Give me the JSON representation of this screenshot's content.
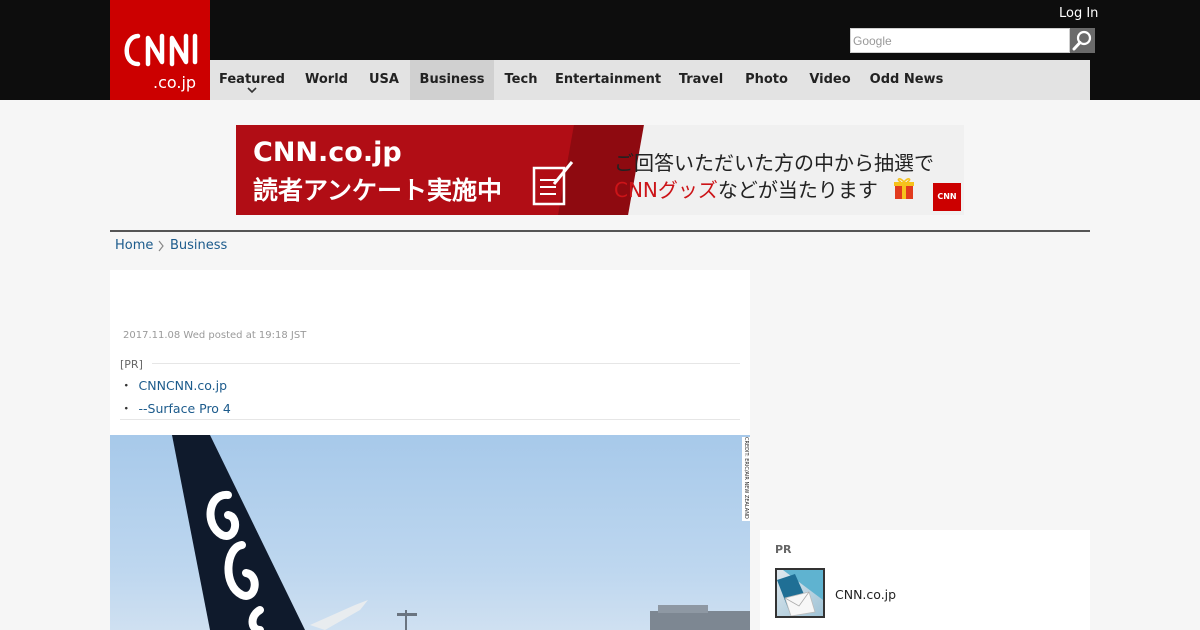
{
  "header": {
    "logo_text": "CNN.co.jp",
    "login_label": "Log In",
    "search_placeholder": "Google"
  },
  "nav": {
    "items": [
      {
        "label": "Featured"
      },
      {
        "label": "World"
      },
      {
        "label": "USA"
      },
      {
        "label": "Business"
      },
      {
        "label": "Tech"
      },
      {
        "label": "Entertainment"
      },
      {
        "label": "Travel"
      },
      {
        "label": "Photo"
      },
      {
        "label": "Video"
      },
      {
        "label": "Odd News"
      }
    ],
    "active": "Business"
  },
  "banner": {
    "line1": "CNN.co.jp",
    "line2": "読者アンケート実施中",
    "right_line1": "ご回答いただいた方の中から抽選で",
    "right_line2_red": "CNNグッズ",
    "right_line2_rest": "などが当たります",
    "logo_text": "CNN"
  },
  "breadcrumb": {
    "home": "Home",
    "section": "Business"
  },
  "article": {
    "date": "2017.11.08 Wed posted at 19:18 JST",
    "pr_label": "[PR]",
    "pr_links": [
      "CNNCNN.co.jp",
      "--Surface Pro 4"
    ],
    "photo_credit": "CREDIT: ERIC/AIR NEW ZEALAND"
  },
  "sidebar": {
    "pr_label": "PR",
    "item_label": "CNN.co.jp"
  },
  "colors": {
    "brand_red": "#cc0000",
    "link_blue": "#1c5b8c",
    "header_black": "#0d0d0d"
  }
}
